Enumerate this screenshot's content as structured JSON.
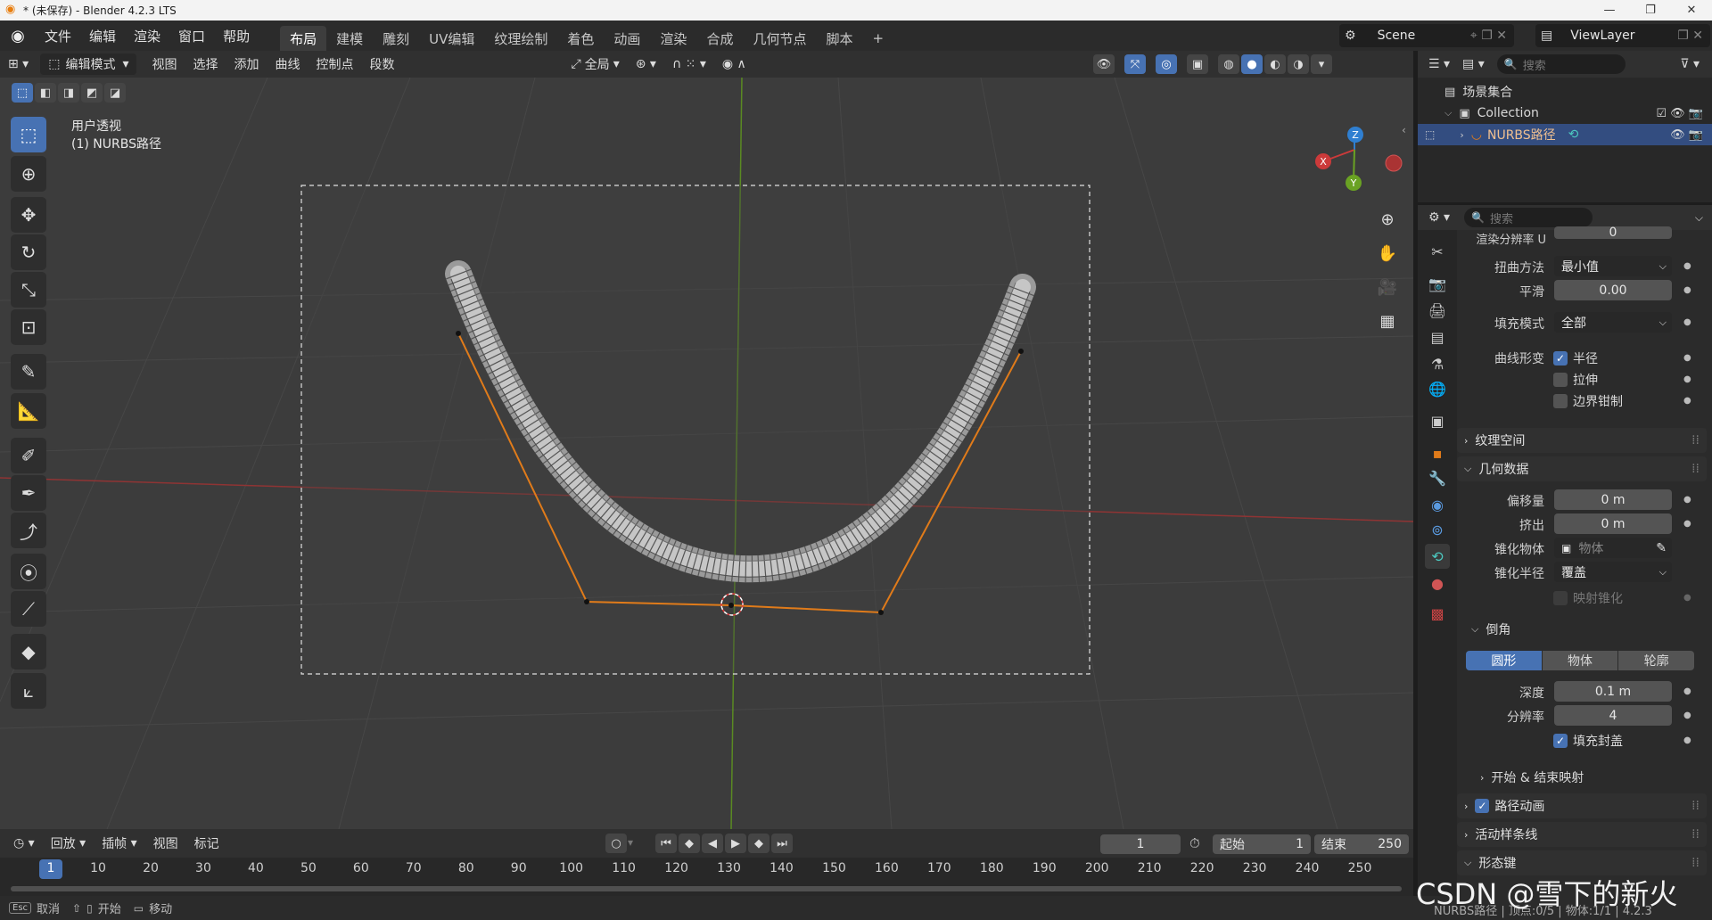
{
  "window": {
    "title": "* (未保存) - Blender 4.2.3 LTS"
  },
  "menu": [
    "文件",
    "编辑",
    "渲染",
    "窗口",
    "帮助"
  ],
  "workspaces": [
    "布局",
    "建模",
    "雕刻",
    "UV编辑",
    "纹理绘制",
    "着色",
    "动画",
    "渲染",
    "合成",
    "几何节点",
    "脚本"
  ],
  "workspace_active": "布局",
  "scene": "Scene",
  "view_layer": "ViewLayer",
  "header3d": {
    "mode": "编辑模式",
    "menus": [
      "视图",
      "选择",
      "添加",
      "曲线",
      "控制点",
      "段数"
    ],
    "orientation": "全局"
  },
  "overlay": {
    "view_name": "用户透视",
    "object_name": "(1) NURBS路径"
  },
  "gizmo": {
    "x": "X",
    "y": "Y",
    "z": "Z"
  },
  "outliner": {
    "search_placeholder": "搜索",
    "scene_collection": "场景集合",
    "collection": "Collection",
    "object": "NURBS路径"
  },
  "props": {
    "search_placeholder": "搜索",
    "render_res_label": "渲染分辨率 U",
    "render_res_value": "0",
    "twist_label": "扭曲方法",
    "twist_value": "最小值",
    "smooth_label": "平滑",
    "smooth_value": "0.00",
    "fill_label": "填充模式",
    "fill_value": "全部",
    "deform_label": "曲线形变",
    "radius": "半径",
    "stretch": "拉伸",
    "bounds_clamp": "边界钳制",
    "texture_space": "纹理空间",
    "geometry": "几何数据",
    "offset_label": "偏移量",
    "offset_value": "0 m",
    "extrude_label": "挤出",
    "extrude_value": "0 m",
    "taper_obj_label": "锥化物体",
    "taper_obj_placeholder": "物体",
    "taper_radius_label": "锥化半径",
    "taper_radius_value": "覆盖",
    "map_taper": "映射锥化",
    "bevel": "倒角",
    "bevel_tabs": [
      "圆形",
      "物体",
      "轮廓"
    ],
    "depth_label": "深度",
    "depth_value": "0.1 m",
    "resolution_label": "分辨率",
    "resolution_value": "4",
    "fill_caps": "填充封盖",
    "start_end_mapping": "开始 & 结束映射",
    "path_anim": "路径动画",
    "active_spline": "活动样条线",
    "shape_keys": "形态键"
  },
  "timeline": {
    "menus": [
      "回放",
      "插帧",
      "视图",
      "标记"
    ],
    "current_frame": "1",
    "start_label": "起始",
    "start_value": "1",
    "end_label": "结束",
    "end_value": "250",
    "ticks": [
      "1",
      "10",
      "20",
      "30",
      "40",
      "50",
      "60",
      "70",
      "80",
      "90",
      "100",
      "110",
      "120",
      "130",
      "140",
      "150",
      "160",
      "170",
      "180",
      "190",
      "200",
      "210",
      "220",
      "230",
      "240",
      "250"
    ]
  },
  "statusbar": {
    "esc": "Esc",
    "cancel": "取消",
    "start": "开始",
    "move": "移动",
    "info": "NURBS路径 | 顶点:0/5 | 物体:1/1 | 4.2.3"
  },
  "watermark": "CSDN @雪下的新火",
  "colors": {
    "accent": "#4772b3",
    "curve_orange": "#e07b1a",
    "x_axis": "#cc3a3a",
    "y_axis": "#6aa223",
    "z_axis": "#2f7fd1"
  }
}
